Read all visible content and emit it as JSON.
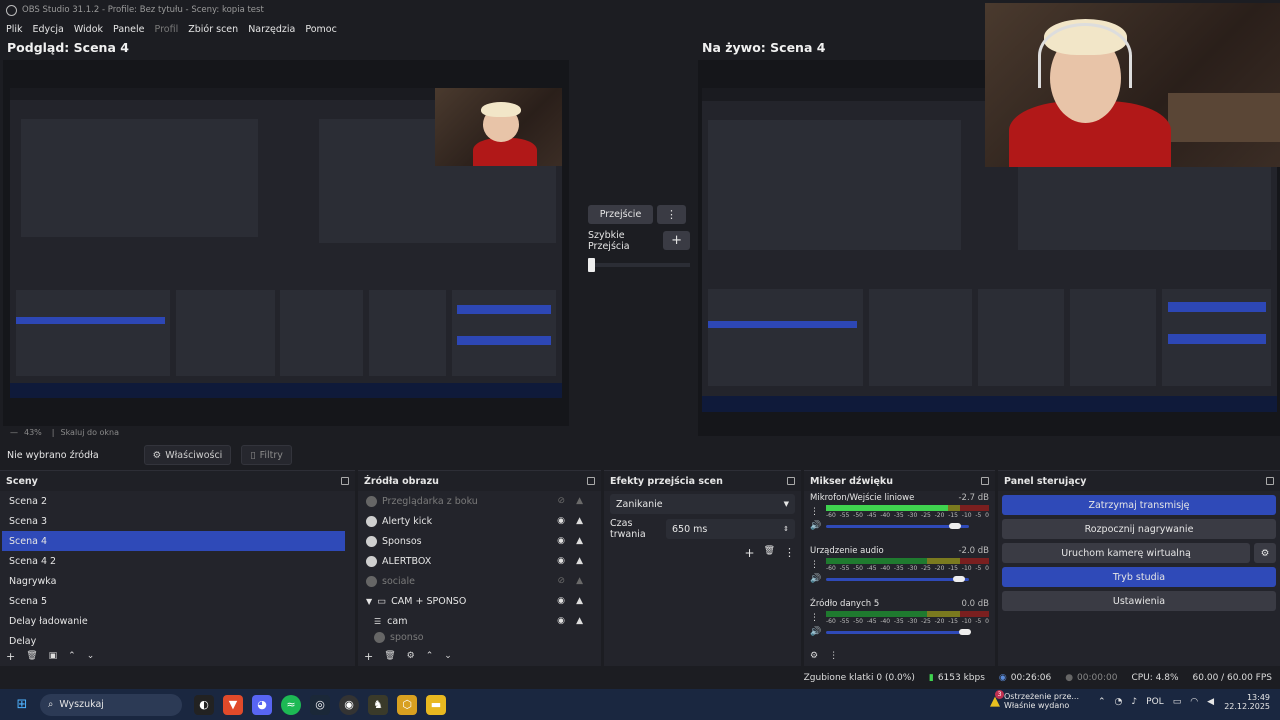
{
  "title": "OBS Studio 31.1.2 - Profile: Bez tytułu - Sceny: kopia test",
  "menu": [
    "Plik",
    "Edycja",
    "Widok",
    "Panele",
    "Profil",
    "Zbiór scen",
    "Narzędzia",
    "Pomoc"
  ],
  "menu_disabled": "Profil",
  "preview_label": "Podgląd: Scena 4",
  "live_label": "Na żywo: Scena 4",
  "transition": {
    "button": "Przejście",
    "quick": "Szybkie Przejścia"
  },
  "zoom": {
    "value": "43%",
    "mode": "Skaluj do okna"
  },
  "source_bar": {
    "label": "Nie wybrano źródła",
    "properties": "Właściwości",
    "filters": "Filtry"
  },
  "scenes": {
    "title": "Sceny",
    "items": [
      "Scena 2",
      "Scena 3",
      "Scena 4",
      "Scena 4 2",
      "Nagrywka",
      "Scena 5",
      "Delay ładowanie",
      "Delay"
    ],
    "selected": "Scena 4"
  },
  "sources": {
    "title": "Źródła obrazu",
    "items": [
      {
        "name": "Przeglądarka z boku",
        "hidden": true
      },
      {
        "name": "Alerty kick",
        "hidden": false
      },
      {
        "name": "Sponsos",
        "hidden": false
      },
      {
        "name": "ALERTBOX",
        "hidden": false
      },
      {
        "name": "sociale",
        "hidden": true
      },
      {
        "name": "CAM + SPONSO",
        "hidden": false
      },
      {
        "name": "cam",
        "hidden": false
      },
      {
        "name": "sponso",
        "hidden": true
      }
    ]
  },
  "transitions": {
    "title": "Efekty przejścia scen",
    "type": "Zanikanie",
    "duration_label": "Czas trwania",
    "duration_value": "650 ms"
  },
  "mixer": {
    "title": "Mikser dźwięku",
    "channels": [
      {
        "name": "Mikrofon/Wejście liniowe",
        "db": "-2.7 dB",
        "level": 0.75,
        "volume": 0.9
      },
      {
        "name": "Urządzenie audio",
        "db": "-2.0 dB",
        "level": 0,
        "volume": 0.93
      },
      {
        "name": "Źródło danych 5",
        "db": "0.0 dB",
        "level": 0,
        "volume": 0.97
      }
    ],
    "scale": [
      "-60",
      "-55",
      "-50",
      "-45",
      "-40",
      "-35",
      "-30",
      "-25",
      "-20",
      "-15",
      "-10",
      "-5",
      "0"
    ]
  },
  "controls": {
    "title": "Panel sterujący",
    "buttons": [
      "Zatrzymaj transmisję",
      "Rozpocznij nagrywanie",
      "Uruchom kamerę wirtualną",
      "Tryb studia",
      "Ustawienia"
    ]
  },
  "status": {
    "dropped": "Zgubione klatki 0 (0.0%)",
    "bitrate": "6153 kbps",
    "stream_time": "00:26:06",
    "rec_time": "00:00:00",
    "cpu": "CPU: 4.8%",
    "fps": "60.00 / 60.00 FPS"
  },
  "taskbar": {
    "search": "Wyszukaj",
    "notify_title": "Ostrzeżenie prze...",
    "notify_sub": "Właśnie wydano",
    "notify_badge": "3",
    "lang": "POL",
    "time": "13:49",
    "date": "22.12.2025"
  },
  "colors": {
    "accent": "#2f4ab8",
    "bg": "#1c1d22",
    "panel": "#23242b",
    "taskbar": "#1a2740"
  }
}
